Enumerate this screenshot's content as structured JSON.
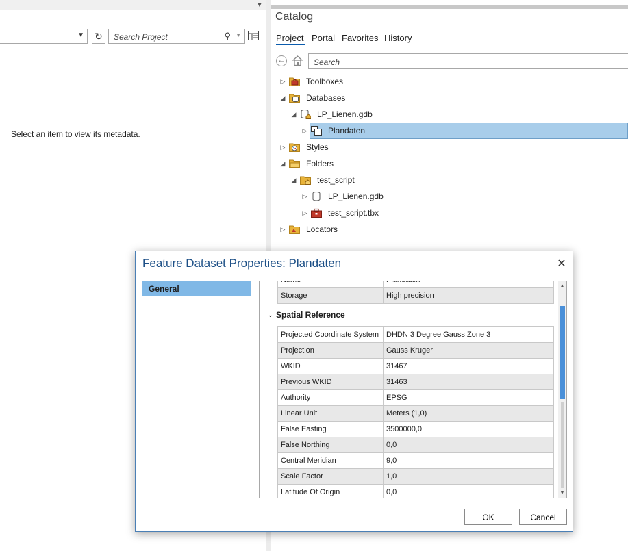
{
  "left_pane": {
    "search_placeholder": "Search Project",
    "message": "Select an item to view its metadata."
  },
  "catalog": {
    "title": "Catalog",
    "tabs": [
      "Project",
      "Portal",
      "Favorites",
      "History"
    ],
    "active_tab": "Project",
    "search_placeholder": "Search",
    "tree": [
      {
        "label": "Toolboxes",
        "icon": "toolbox-folder-icon",
        "toggle": "▷"
      },
      {
        "label": "Databases",
        "icon": "database-folder-icon",
        "toggle": "◢"
      },
      {
        "label": "LP_Lienen.gdb",
        "icon": "geodatabase-home-icon",
        "toggle": "◢"
      },
      {
        "label": "Plandaten",
        "icon": "feature-dataset-icon",
        "toggle": "▷",
        "selected": true
      },
      {
        "label": "Styles",
        "icon": "styles-folder-icon",
        "toggle": "▷"
      },
      {
        "label": "Folders",
        "icon": "folders-icon",
        "toggle": "◢"
      },
      {
        "label": "test_script",
        "icon": "home-folder-icon",
        "toggle": "◢"
      },
      {
        "label": "LP_Lienen.gdb",
        "icon": "geodatabase-icon",
        "toggle": "▷"
      },
      {
        "label": "test_script.tbx",
        "icon": "toolbox-icon",
        "toggle": "▷"
      },
      {
        "label": "Locators",
        "icon": "locators-folder-icon",
        "toggle": "▷"
      }
    ]
  },
  "dialog": {
    "title": "Feature Dataset Properties: Plandaten",
    "close_symbol": "✕",
    "sidebar_items": [
      "General"
    ],
    "partial_rows": [
      {
        "key": "Name",
        "value": "Plandaten"
      },
      {
        "key": "Storage",
        "value": "High precision"
      }
    ],
    "section_title": "Spatial Reference",
    "section_chevron": "⌄",
    "spatial_reference": [
      {
        "key": "Projected Coordinate System",
        "value": "DHDN 3 Degree Gauss Zone 3"
      },
      {
        "key": "Projection",
        "value": "Gauss Kruger"
      },
      {
        "key": "WKID",
        "value": "31467"
      },
      {
        "key": "Previous WKID",
        "value": "31463"
      },
      {
        "key": "Authority",
        "value": "EPSG"
      },
      {
        "key": "Linear Unit",
        "value": "Meters (1,0)"
      },
      {
        "key": "False Easting",
        "value": "3500000,0"
      },
      {
        "key": "False Northing",
        "value": "0,0"
      },
      {
        "key": "Central Meridian",
        "value": "9,0"
      },
      {
        "key": "Scale Factor",
        "value": "1,0"
      },
      {
        "key": "Latitude Of Origin",
        "value": "0,0"
      }
    ],
    "ok_label": "OK",
    "cancel_label": "Cancel"
  },
  "colors": {
    "accent": "#0b5cad",
    "selection": "#a8cdea",
    "sidebar_selected": "#80b8e6",
    "dialog_title": "#1c4f86",
    "scroll_thumb": "#4a90d9"
  }
}
